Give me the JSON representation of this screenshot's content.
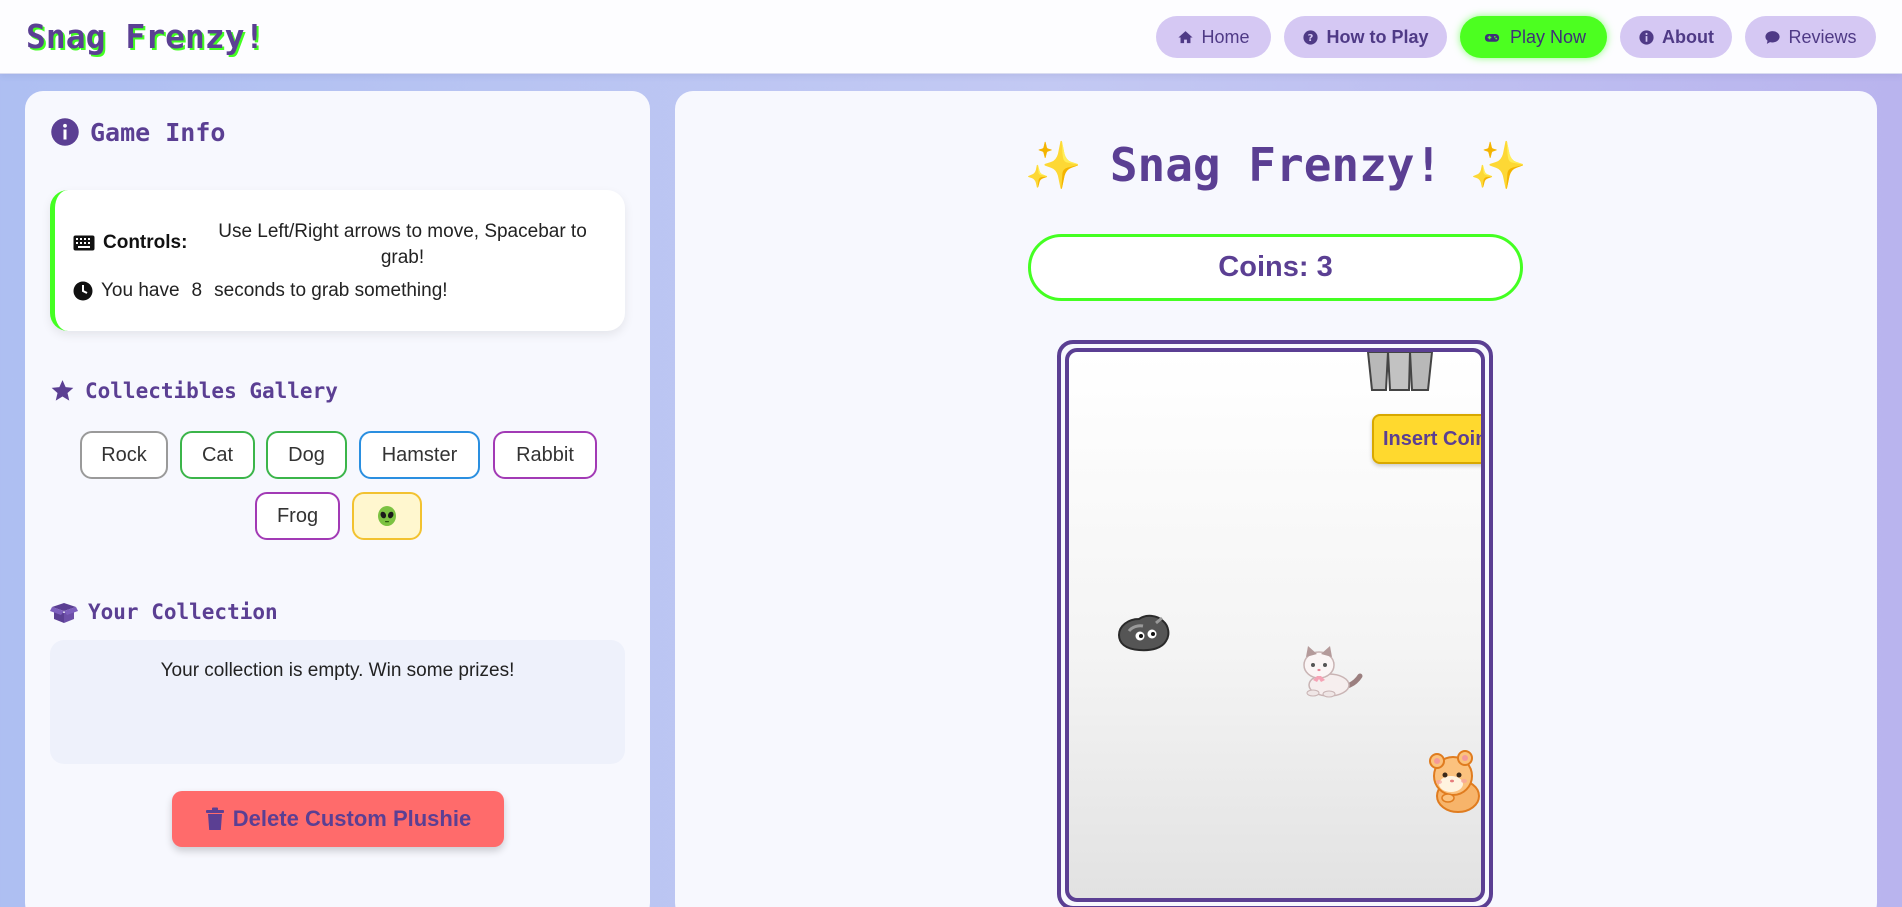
{
  "brand": "Snag Frenzy!",
  "nav": [
    {
      "label": "Home",
      "icon": "home-icon"
    },
    {
      "label": "How to Play",
      "icon": "question-icon"
    },
    {
      "label": "Play Now",
      "icon": "gamepad-icon",
      "active": true
    },
    {
      "label": "About",
      "icon": "info-icon"
    },
    {
      "label": "Reviews",
      "icon": "comment-icon"
    }
  ],
  "game_info": {
    "title": "Game Info",
    "controls_label": "Controls:",
    "controls_text": "Use Left/Right arrows to move, Spacebar to grab!",
    "timer_prefix": "You have",
    "timer_seconds": "8",
    "timer_suffix": "seconds to grab something!"
  },
  "gallery": {
    "title": "Collectibles Gallery",
    "items": [
      {
        "label": "Rock",
        "color": "#9a9a9a"
      },
      {
        "label": "Cat",
        "color": "#3bb54a"
      },
      {
        "label": "Dog",
        "color": "#3bb54a"
      },
      {
        "label": "Hamster",
        "color": "#2a8fe0"
      },
      {
        "label": "Rabbit",
        "color": "#a23ab5"
      },
      {
        "label": "Frog",
        "color": "#a23ab5"
      },
      {
        "label": "",
        "icon": "alien-icon",
        "color": "#f2c230",
        "background": "#fff7cf"
      }
    ]
  },
  "collection": {
    "title": "Your Collection",
    "empty_text": "Your collection is empty. Win some prizes!"
  },
  "delete_button": "Delete Custom Plushie",
  "game": {
    "title": "Snag Frenzy!",
    "title_decor": "✨",
    "coins_text": "Coins: 3",
    "insert_coin_label": "Insert Coin",
    "prizes_visible": [
      "rock-plushie",
      "cat-plushie",
      "hamster-plushie"
    ]
  },
  "colors": {
    "accent_purple": "#5b3f93",
    "accent_green": "#44ff22",
    "nav_pill": "#d5c8f3",
    "delete_red": "#ff6b6b",
    "coin_yellow": "#ffd92e"
  }
}
